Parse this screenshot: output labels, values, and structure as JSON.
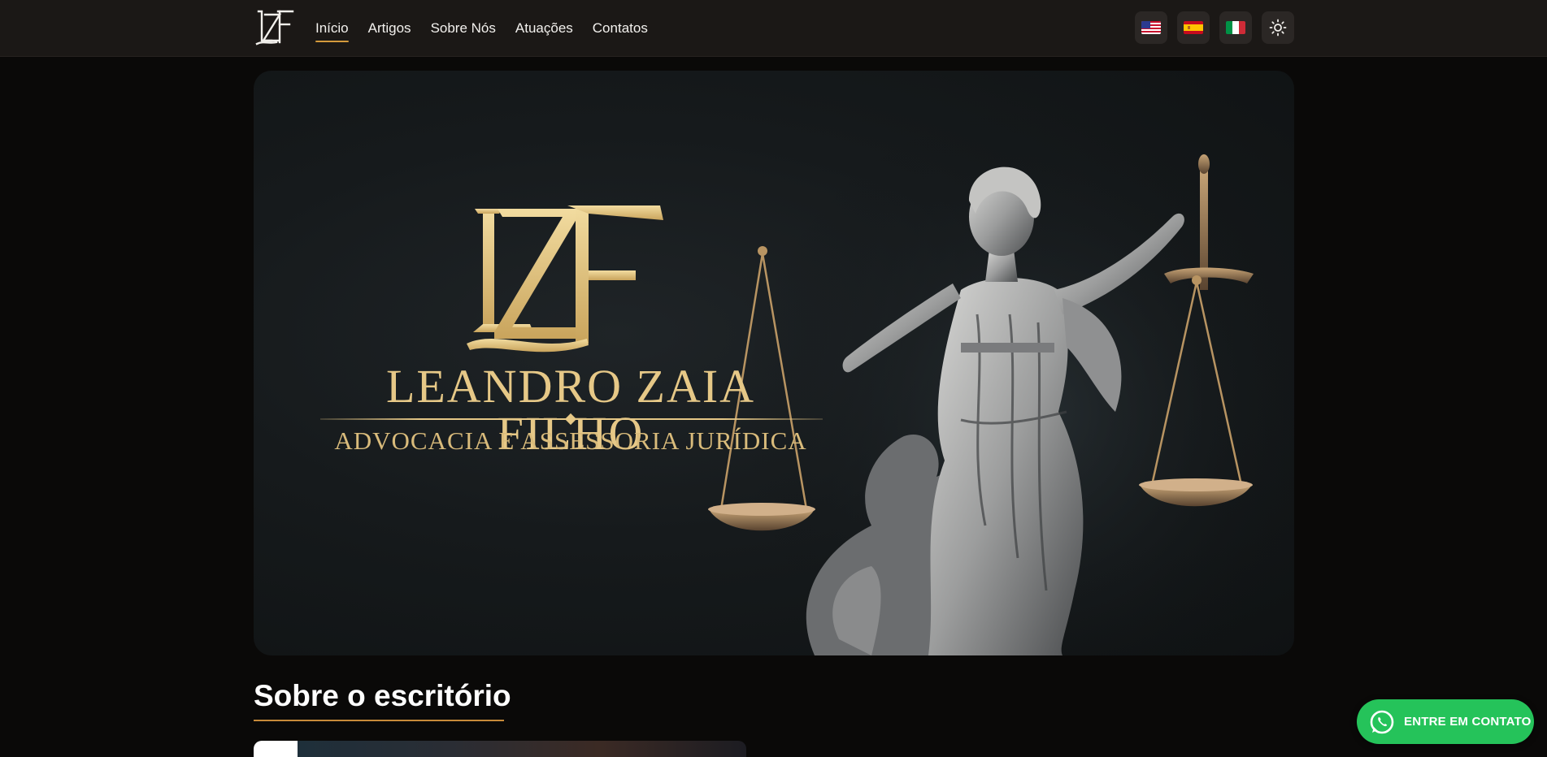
{
  "header": {
    "logo_text": "LZF",
    "nav": [
      {
        "label": "Início",
        "active": true
      },
      {
        "label": "Artigos",
        "active": false
      },
      {
        "label": "Sobre Nós",
        "active": false
      },
      {
        "label": "Atuações",
        "active": false
      },
      {
        "label": "Contatos",
        "active": false
      }
    ],
    "languages": [
      {
        "icon": "us-flag-icon"
      },
      {
        "icon": "es-flag-icon"
      },
      {
        "icon": "it-flag-icon"
      }
    ],
    "theme_toggle_icon": "sun-icon"
  },
  "hero": {
    "monogram": "LZF",
    "title": "LEANDRO ZAIA FILHO",
    "subtitle": "ADVOCACIA E ASSESSORIA JURÍDICA",
    "image": "lady-justice-statue",
    "accent_color": "#e6c887"
  },
  "section": {
    "title": "Sobre o escritório"
  },
  "whatsapp": {
    "label": "ENTRE EM CONTATO",
    "icon": "whatsapp-icon",
    "color": "#25c35a"
  },
  "colors": {
    "page_bg": "#0a0908",
    "header_bg": "#1b1816",
    "nav_active_underline": "#d49a3c",
    "section_underline": "#c78a3a"
  }
}
